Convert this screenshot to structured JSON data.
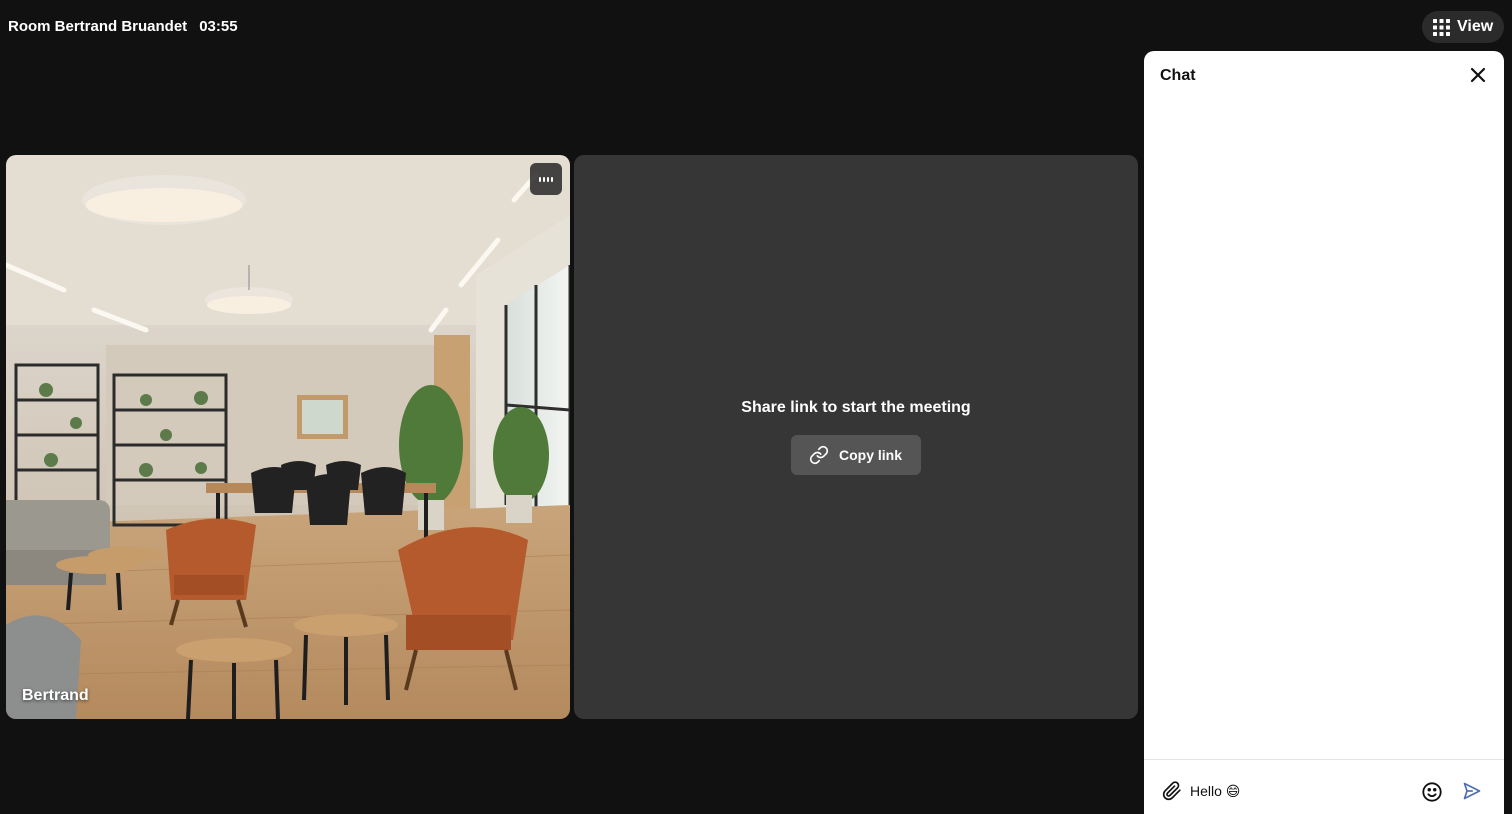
{
  "header": {
    "room_name": "Room Bertrand Bruandet",
    "timer": "03:55",
    "view_label": "View"
  },
  "tiles": {
    "participant": {
      "name": "Bertrand",
      "menu_icon": "more-options-icon",
      "media": "video feed: modern office lounge with orange armchairs, round side tables, shelves with plants and a dining table"
    },
    "invite": {
      "message": "Share link to start the meeting",
      "copy_label": "Copy link",
      "copy_icon": "link-icon"
    }
  },
  "chat": {
    "title": "Chat",
    "close_icon": "close-icon",
    "input_value": "Hello 😄",
    "attach_icon": "paperclip-icon",
    "emoji_icon": "smiley-icon",
    "send_icon": "send-icon"
  },
  "colors": {
    "background": "#111111",
    "tile_empty": "#363636",
    "button": "#555555",
    "chat_panel": "#ffffff"
  }
}
